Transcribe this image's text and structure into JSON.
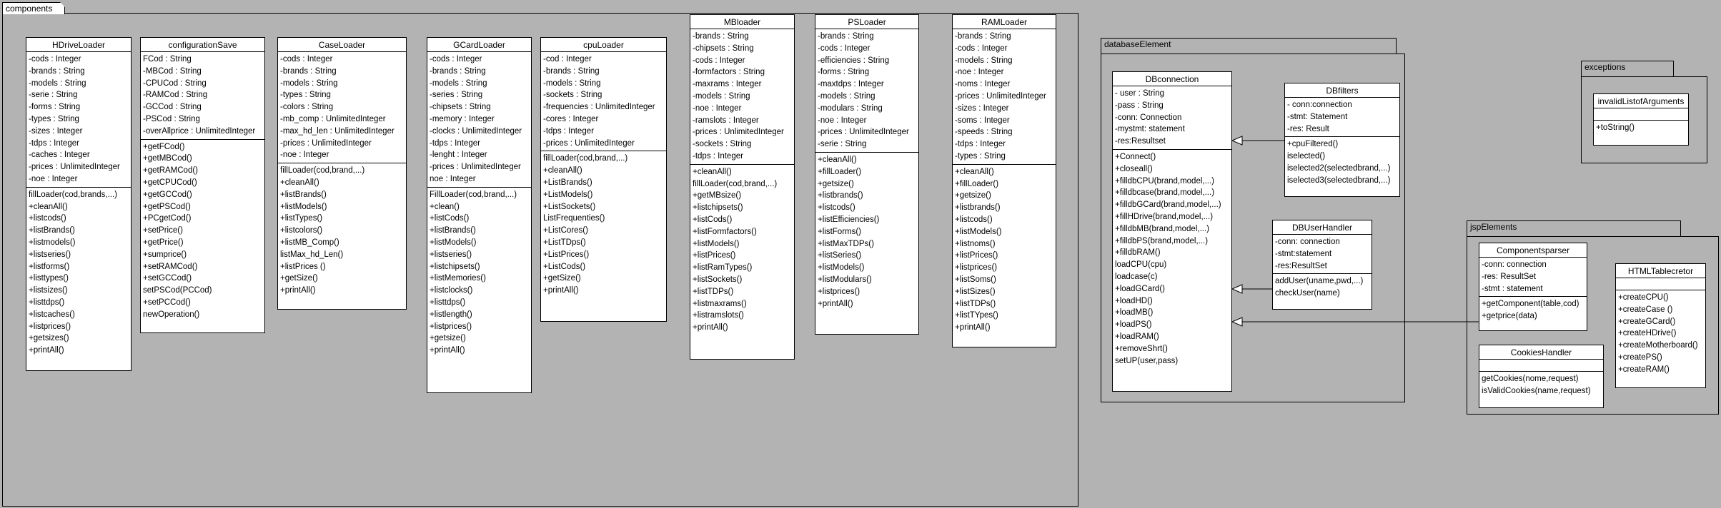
{
  "packages": {
    "components": "components",
    "databaseElement": "databaseElement",
    "exceptions": "exceptions",
    "jspElements": "jspElements"
  },
  "classes": {
    "hdrive": {
      "name": "HDriveLoader",
      "attributes": [
        "-cods : Integer",
        "-brands : String",
        "-models : String",
        "-serie : String",
        "-forms : String",
        "-types : String",
        "-sizes : Integer",
        "-tdps : Integer",
        "-caches : Integer",
        "-prices : UnlimitedInteger",
        "-noe : Integer"
      ],
      "operations": [
        "fillLoader(cod,brands,...)",
        "+cleanAll()",
        "+listcods()",
        "+listBrands()",
        "+listmodels()",
        "+listseries()",
        "+listforms()",
        "+listtypes()",
        "+listsizes()",
        "+listtdps()",
        "+listcaches()",
        "+listprices()",
        "+getsizes()",
        "+printAll()"
      ]
    },
    "configsave": {
      "name": "configurationSave",
      "attributes": [
        "FCod : String",
        "-MBCod : String",
        "-CPUCod : String",
        "-RAMCod : String",
        "-GCCod : String",
        "-PSCod : String",
        "-overAllprice : UnlimitedInteger"
      ],
      "operations": [
        "+getFCod()",
        "+getMBCod()",
        "+getRAMCod()",
        "+getCPUCod()",
        "+getGCCod()",
        "+getPSCod()",
        "+PCgetCod()",
        "+setPrice()",
        "+getPrice()",
        "+sumprice()",
        "+setRAMCod()",
        "+setGCCod()",
        "setPSCod(PCCod)",
        "+setPCCod()",
        "newOperation()"
      ]
    },
    "caseloader": {
      "name": "CaseLoader",
      "attributes": [
        "-cods : Integer",
        "-brands : String",
        "-models : String",
        "-types : String",
        "-colors : String",
        "-mb_comp : UnlimitedInteger",
        "-max_hd_len : UnlimitedInteger",
        "-prices : UnlimitedInteger",
        "-noe : Integer"
      ],
      "operations": [
        "fillLoader(cod,brand,...)",
        "+cleanAll()",
        "+listBrands()",
        "+listModels()",
        "+listTypes()",
        "+listcolors()",
        "+listMB_Comp()",
        "listMax_hd_Len()",
        "+listPrices ()",
        "+getSize()",
        "+printAll()"
      ]
    },
    "gcard": {
      "name": "GCardLoader",
      "attributes": [
        "-cods : Integer",
        "-brands : String",
        "-models : String",
        "-series : String",
        "-chipsets : String",
        "-memory : Integer",
        "-clocks : UnlimitedInteger",
        "-tdps : Integer",
        "-lenght : Integer",
        "-prices : UnlimitedInteger",
        "noe : Integer"
      ],
      "operations": [
        "FillLoader(cod,brand,...)",
        "+clean()",
        "+listCods()",
        "+listBrands()",
        "+listModels()",
        "+listseries()",
        "+listchipsets()",
        "+listMemories()",
        "+listclocks()",
        "+listtdps()",
        "+listlength()",
        "+listprices()",
        "+getsize()",
        "+printAll()"
      ]
    },
    "cpu": {
      "name": "cpuLoader",
      "attributes": [
        "-cod : Integer",
        "-brands : String",
        "-models : String",
        "-sockets : String",
        "-frequencies : UnlimitedInteger",
        "-cores : Integer",
        "-tdps : Integer",
        "-prices : UnlimitedInteger"
      ],
      "operations": [
        "fillLoader(cod,brand,...)",
        "+cleanAll()",
        "+ListBrands()",
        "+ListModels()",
        "+ListSockets()",
        "ListFrequenties()",
        "+ListCores()",
        "+ListTDps()",
        "+ListPrices()",
        "+ListCods()",
        "+getSize()",
        "+printAll()"
      ]
    },
    "mb": {
      "name": "MBloader",
      "attributes": [
        "-brands : String",
        "-chipsets : String",
        "-cods : Integer",
        "-formfactors : String",
        "-maxrams : Integer",
        "-models : String",
        "-noe : Integer",
        "-ramslots : Integer",
        "-prices : UnlimitedInteger",
        "-sockets : String",
        "-tdps : Integer"
      ],
      "operations": [
        "+cleanAll()",
        "fillLoader(cod,brand,...)",
        "+getMBsize()",
        "+listchipsets()",
        "+listCods()",
        "+listFormfactors()",
        "+listModels()",
        "+listPrices()",
        "+listRamTypes()",
        "+listSockets()",
        "+listTDPs()",
        "+listmaxrams()",
        "+listramslots()",
        "+printAll()"
      ]
    },
    "ps": {
      "name": "PSLoader",
      "attributes": [
        "-brands : String",
        "-cods : Integer",
        "-efficiencies : String",
        "-forms : String",
        "-maxtdps : Integer",
        "-models : String",
        "-modulars : String",
        "-noe : Integer",
        "-prices : UnlimitedInteger",
        "-serie : String"
      ],
      "operations": [
        "+cleanAll()",
        "+fillLoader()",
        "+getsize()",
        "+listbrands()",
        "+listcods()",
        "+listEfficiencies()",
        "+listForms()",
        "+listMaxTDPs()",
        "+listSeries()",
        "+listModels()",
        "+listModulars()",
        "+listprices()",
        "+printAll()"
      ]
    },
    "ram": {
      "name": "RAMLoader",
      "attributes": [
        "-brands : String",
        "-cods : Integer",
        "-models : String",
        "-noe : Integer",
        "-noms : Integer",
        "-prices : UnlimitedInteger",
        "-sizes : Integer",
        "-soms : Integer",
        "-speeds : String",
        "-tdps : Integer",
        "-types : String"
      ],
      "operations": [
        "+cleanAll()",
        "+fillLoader()",
        "+getsize()",
        "+listbrands()",
        "+listcods()",
        "+listModels()",
        "+listnoms()",
        "+listPrices()",
        "+listprices()",
        "+listSoms()",
        "+listSizes()",
        "+listTDPs()",
        "+listTYpes()",
        "+printAll()"
      ]
    },
    "dbconn": {
      "name": "DBconnection",
      "attributes": [
        "- user : String",
        "-pass : String",
        "-conn: Connection",
        "-mystmt: statement",
        "-res:Resultset"
      ],
      "operations": [
        "+Connect()",
        "+closeall()",
        "+filldbCPU(brand,model,...)",
        "+filldbcase(brand,model,...)",
        "+filldbGCard(brand,model,...)",
        "+fillHDrive(brand,model,...)",
        "+filldbMB(brand,model,...)",
        "+filldbPS(brand,model,...)",
        "+filldbRAM()",
        "loadCPU(cpu)",
        "loadcase(c)",
        "+loadGCard()",
        "+loadHD()",
        "+loadMB()",
        "+loadPS()",
        "+loadRAM()",
        "+removeShrt()",
        "setUP(user,pass)"
      ]
    },
    "dbfilters": {
      "name": "DBfilters",
      "attributes": [
        "- conn:connection",
        "-stmt: Statement",
        "-res: Result"
      ],
      "operations": [
        "+cpuFiltered()",
        "iselected()",
        "iselected2(selectedbrand,...)",
        "iselected3(selectedbrand,...)"
      ]
    },
    "dbuser": {
      "name": "DBUserHandler",
      "attributes": [
        "-conn: connection",
        "-stmt:statement",
        "-res:ResultSet"
      ],
      "operations": [
        "addUser(uname,pwd,...)",
        "checkUser(name)"
      ]
    },
    "invalid": {
      "name": "invalidListofArguments",
      "attributes": [],
      "operations": [
        "+toString()"
      ]
    },
    "compparser": {
      "name": "Componentsparser",
      "attributes": [
        "-conn: connection",
        "-res: ResultSet",
        "-stmt : statement"
      ],
      "operations": [
        "+getComponent(table,cod)",
        "+getprice(data)"
      ]
    },
    "cookies": {
      "name": "CookiesHandler",
      "attributes": [],
      "operations": [
        "getCookies(nome,request)",
        "isValidCookies(name,request)"
      ]
    },
    "htmltable": {
      "name": "HTMLTablecretor",
      "attributes": [],
      "operations": [
        "+createCPU()",
        "+createCase ()",
        "+createGCard()",
        "+createHDrive()",
        "+createMotherboard()",
        "+createPS()",
        "+createRAM()"
      ]
    }
  }
}
